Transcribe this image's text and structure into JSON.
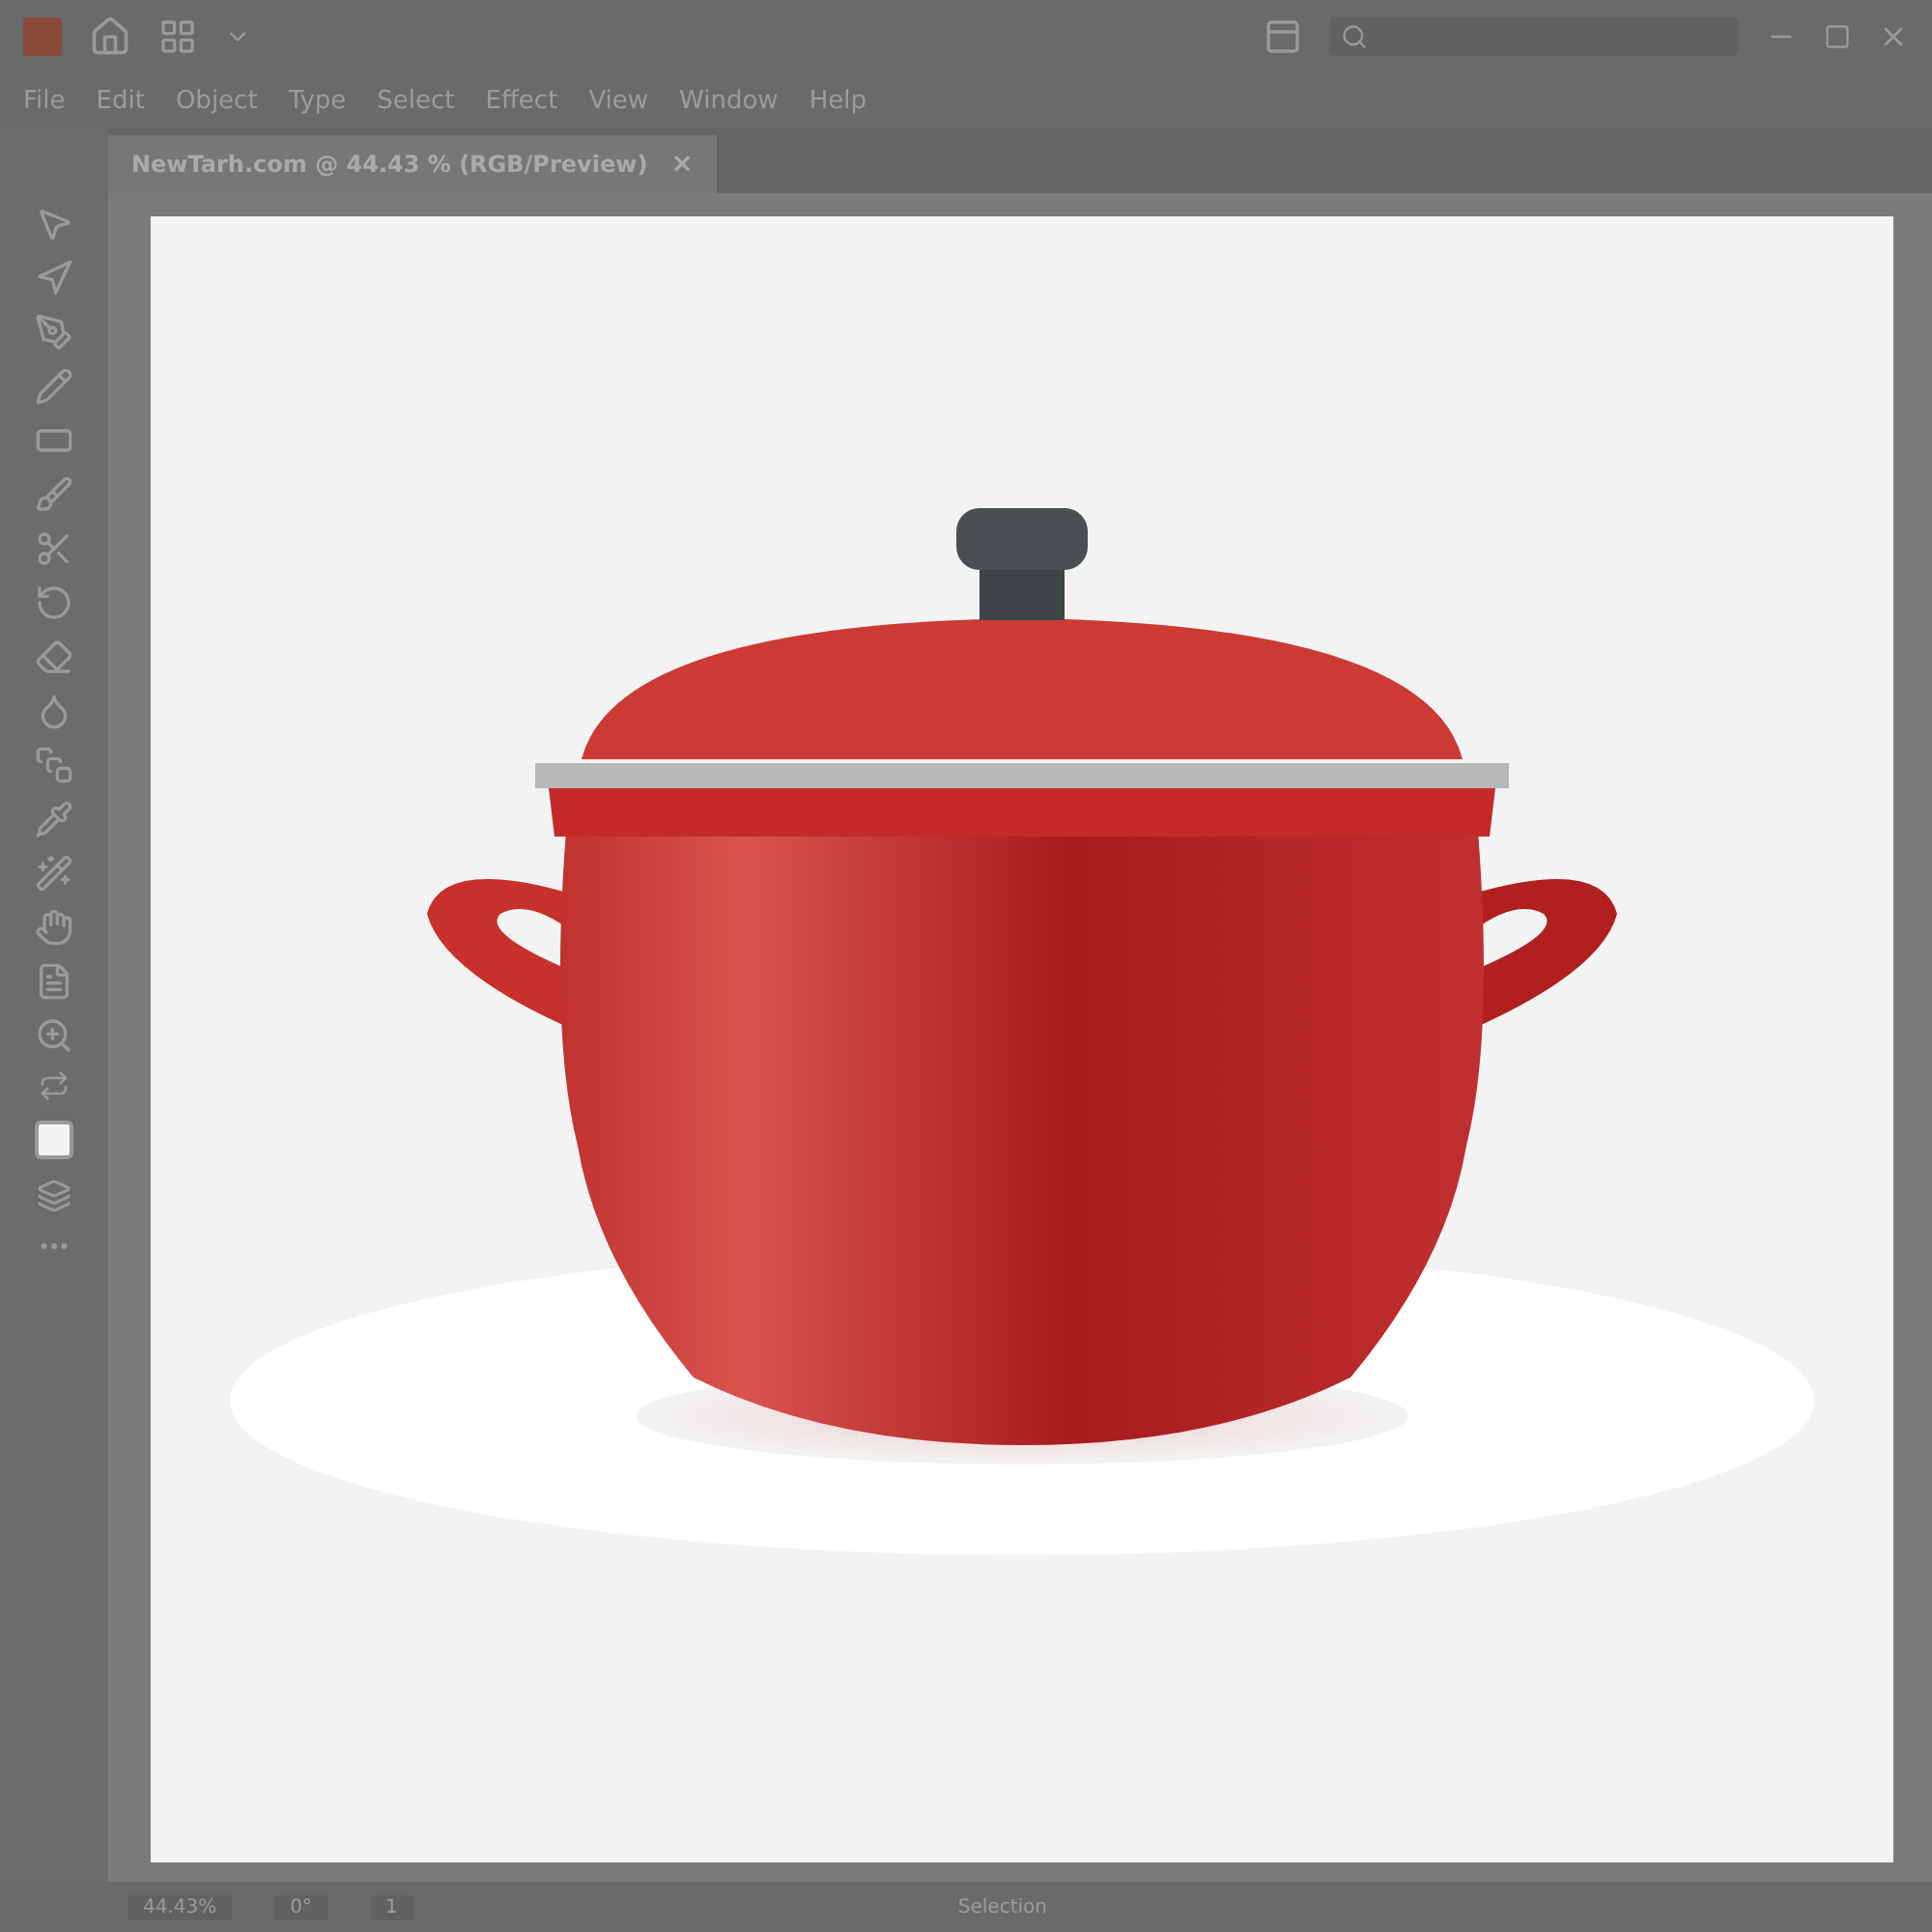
{
  "menu": [
    "File",
    "Edit",
    "Object",
    "Type",
    "Select",
    "Effect",
    "View",
    "Window",
    "Help"
  ],
  "document_tabs": [
    {
      "title": "NewTarh.com @ 44.43 % (RGB/Preview)",
      "close": "×",
      "selected": true
    }
  ],
  "status_bar": {
    "zoom": "44.43%",
    "rotation": "0°",
    "artboard": "1",
    "tool": "Selection"
  }
}
